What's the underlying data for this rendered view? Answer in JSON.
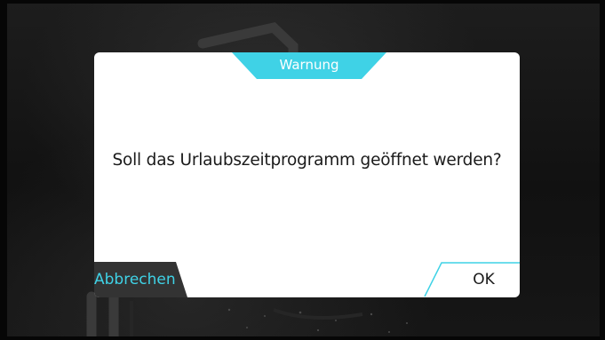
{
  "dialog": {
    "title": "Warnung",
    "message": "Soll das Urlaubszeitprogramm geöffnet werden?",
    "cancel_label": "Abbrechen",
    "ok_label": "OK"
  },
  "colors": {
    "accent": "#3fd2e6",
    "dialog_background": "#ffffff",
    "cancel_button_background": "#333333",
    "screen_background": "#111111"
  }
}
